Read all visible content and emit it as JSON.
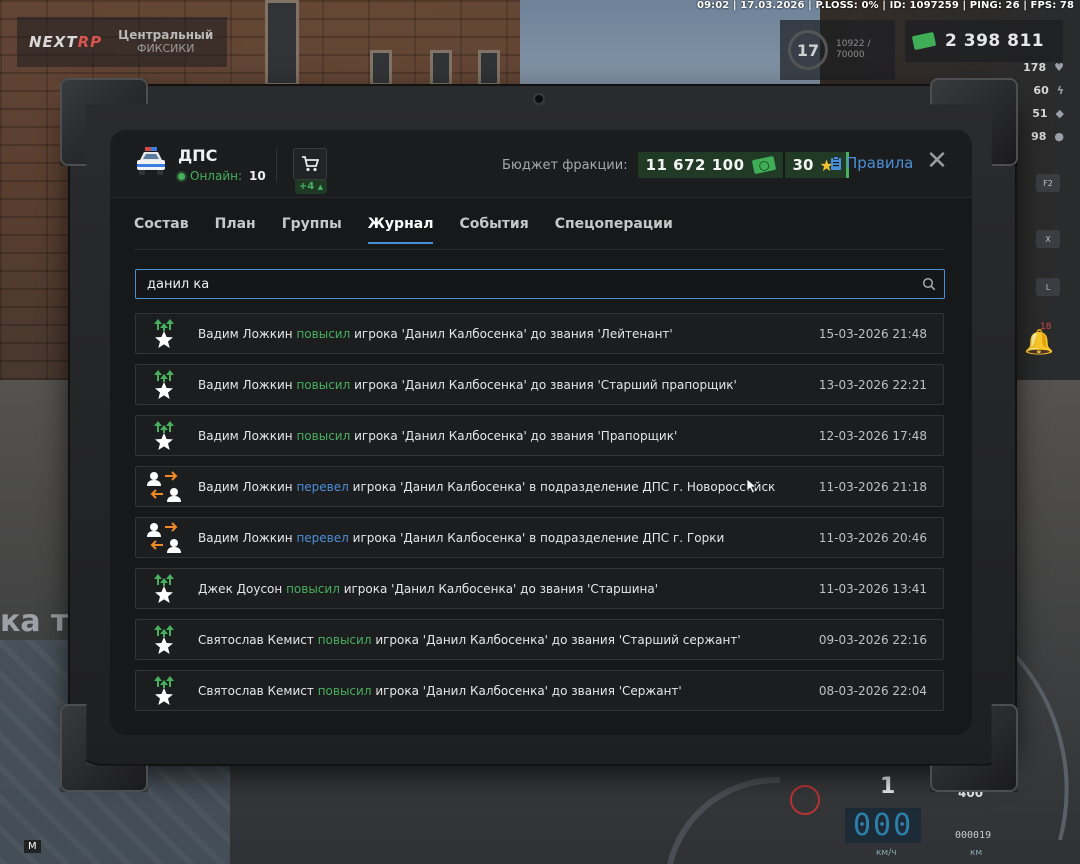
{
  "status_bar": "09:02 | 17.03.2026 | P.LOSS: 0% | ID: 1097259 | PING: 26 | FPS: 78",
  "logo": {
    "brand_prefix": "NEXT",
    "brand_suffix": "RP",
    "server": "Центральный",
    "subtitle": "ФИКСИКИ"
  },
  "hud": {
    "level": "17",
    "xp": "10922 /",
    "xp_max": "70000",
    "money": "2 398 811",
    "stats": [
      "178",
      "60",
      "51",
      "98"
    ]
  },
  "speedometer": {
    "digits": "000",
    "odometer": "000019",
    "gear": "1",
    "max": "400",
    "unit": "км/ч",
    "unit2": "км"
  },
  "notifications": {
    "count": "18"
  },
  "side_keys": [
    "F2",
    "X",
    "L"
  ],
  "minimap_key": "M",
  "background_text": "ка т",
  "faction": {
    "name": "ДПС",
    "online_label": "Онлайн:",
    "online_count": "10",
    "cart_badge": "+4"
  },
  "budget": {
    "label": "Бюджет фракции:",
    "value": "11 672 100",
    "stars": "30"
  },
  "rules_label": "Правила",
  "close_label": "✕",
  "tabs": [
    {
      "label": "Состав",
      "active": false
    },
    {
      "label": "План",
      "active": false
    },
    {
      "label": "Группы",
      "active": false
    },
    {
      "label": "Журнал",
      "active": true
    },
    {
      "label": "События",
      "active": false
    },
    {
      "label": "Спецоперации",
      "active": false
    }
  ],
  "search": {
    "value": "данил ка",
    "placeholder": ""
  },
  "colors": {
    "accent_blue": "#4a8fd8",
    "accent_green": "#46b05e",
    "orange": "#f08a24",
    "star_gold": "#f2c230"
  },
  "log": [
    {
      "icon": "promote",
      "actor": "Вадим Ложкин",
      "action": "повысил",
      "rest": "игрока 'Данил Калбосенка' до звания 'Лейтенант'",
      "time": "15-03-2026 21:48"
    },
    {
      "icon": "promote",
      "actor": "Вадим Ложкин",
      "action": "повысил",
      "rest": "игрока 'Данил Калбосенка' до звания 'Старший прапорщик'",
      "time": "13-03-2026 22:21"
    },
    {
      "icon": "promote",
      "actor": "Вадим Ложкин",
      "action": "повысил",
      "rest": "игрока 'Данил Калбосенка' до звания 'Прапорщик'",
      "time": "12-03-2026 17:48"
    },
    {
      "icon": "transfer",
      "actor": "Вадим Ложкин",
      "action": "перевел",
      "rest": "игрока 'Данил Калбосенка' в подразделение ДПС г. Новороссийск",
      "time": "11-03-2026 21:18"
    },
    {
      "icon": "transfer",
      "actor": "Вадим Ложкин",
      "action": "перевел",
      "rest": "игрока 'Данил Калбосенка' в подразделение ДПС г. Горки",
      "time": "11-03-2026 20:46"
    },
    {
      "icon": "promote",
      "actor": "Джек Доусон",
      "action": "повысил",
      "rest": "игрока 'Данил Калбосенка' до звания 'Старшина'",
      "time": "11-03-2026 13:41"
    },
    {
      "icon": "promote",
      "actor": "Святослав Кемист",
      "action": "повысил",
      "rest": "игрока 'Данил Калбосенка' до звания 'Старший сержант'",
      "time": "09-03-2026 22:16"
    },
    {
      "icon": "promote",
      "actor": "Святослав Кемист",
      "action": "повысил",
      "rest": "игрока 'Данил Калбосенка' до звания 'Сержант'",
      "time": "08-03-2026 22:04"
    }
  ]
}
